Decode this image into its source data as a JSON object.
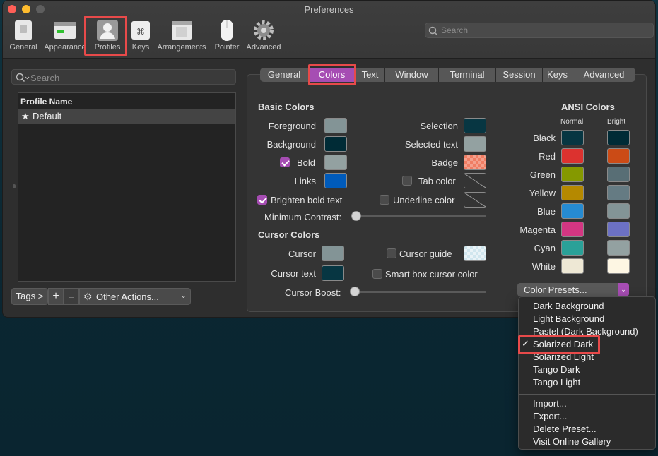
{
  "window": {
    "title": "Preferences"
  },
  "toolbar": {
    "items": [
      {
        "label": "General",
        "icon": "general-icon"
      },
      {
        "label": "Appearance",
        "icon": "appearance-icon"
      },
      {
        "label": "Profiles",
        "icon": "profiles-icon"
      },
      {
        "label": "Keys",
        "icon": "keys-icon"
      },
      {
        "label": "Arrangements",
        "icon": "arrangements-icon"
      },
      {
        "label": "Pointer",
        "icon": "pointer-icon"
      },
      {
        "label": "Advanced",
        "icon": "advanced-gear-icon"
      }
    ],
    "search_placeholder": "Search"
  },
  "sidebar": {
    "search_placeholder": "Search",
    "column_header": "Profile Name",
    "profiles": [
      {
        "name": "Default",
        "star": "★"
      }
    ],
    "tags_button": "Tags >",
    "add": "+",
    "remove": "–",
    "other_actions": "Other Actions..."
  },
  "tabs": [
    "General",
    "Colors",
    "Text",
    "Window",
    "Terminal",
    "Session",
    "Keys",
    "Advanced"
  ],
  "basic_colors": {
    "heading": "Basic Colors",
    "foreground": "Foreground",
    "background": "Background",
    "bold": "Bold",
    "links": "Links",
    "selection": "Selection",
    "selected_text": "Selected text",
    "badge": "Badge",
    "tab_color": "Tab color",
    "underline_color": "Underline color",
    "brighten_bold": "Brighten bold text",
    "min_contrast": "Minimum Contrast:",
    "min_contrast_value": 0
  },
  "cursor_colors": {
    "heading": "Cursor Colors",
    "cursor": "Cursor",
    "cursor_text": "Cursor text",
    "cursor_guide": "Cursor guide",
    "smart_box": "Smart box cursor color",
    "boost": "Cursor Boost:",
    "boost_value": 0
  },
  "ansi": {
    "heading": "ANSI Colors",
    "normal": "Normal",
    "bright": "Bright",
    "rows": [
      {
        "name": "Black",
        "normal": "#073642",
        "bright": "#002b36"
      },
      {
        "name": "Red",
        "normal": "#dc322f",
        "bright": "#cb4b16"
      },
      {
        "name": "Green",
        "normal": "#859900",
        "bright": "#586e75"
      },
      {
        "name": "Yellow",
        "normal": "#b58900",
        "bright": "#657b83"
      },
      {
        "name": "Blue",
        "normal": "#268bd2",
        "bright": "#839496"
      },
      {
        "name": "Magenta",
        "normal": "#d33682",
        "bright": "#6c71c4"
      },
      {
        "name": "Cyan",
        "normal": "#2aa198",
        "bright": "#93a1a1"
      },
      {
        "name": "White",
        "normal": "#eee8d5",
        "bright": "#fdf6e3"
      }
    ]
  },
  "colors": {
    "foreground": "#839496",
    "background": "#002b36",
    "bold": "#93a1a1",
    "links": "#005bbb",
    "selection": "#073642",
    "selected_text": "#93a1a1",
    "badge": "#f07d63",
    "cursor": "#839496",
    "cursor_text": "#073642",
    "accent": "#a64db3",
    "highlight": "#e84a4a"
  },
  "presets": {
    "button": "Color Presets...",
    "menu": [
      "Dark Background",
      "Light Background",
      "Pastel (Dark Background)",
      "Solarized Dark",
      "Solarized Light",
      "Tango Dark",
      "Tango Light"
    ],
    "checked": "✓",
    "actions": [
      "Import...",
      "Export...",
      "Delete Preset...",
      "Visit Online Gallery"
    ]
  }
}
